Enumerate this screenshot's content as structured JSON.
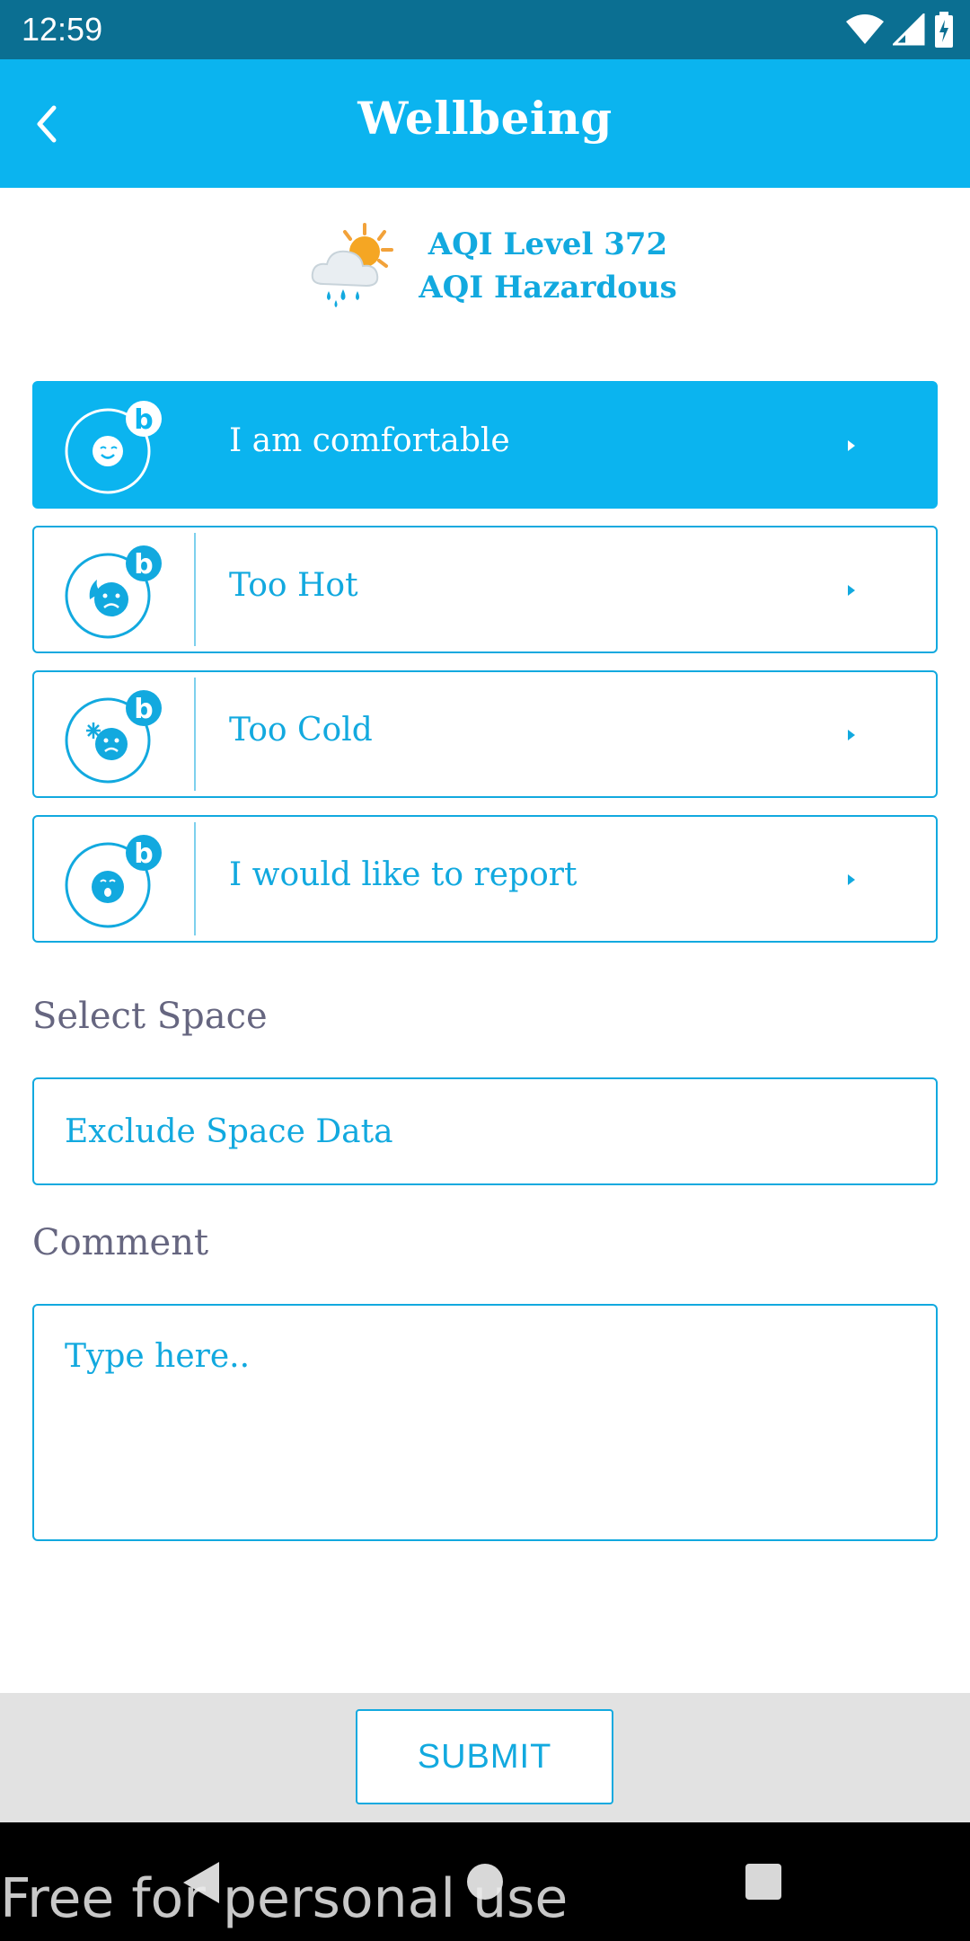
{
  "status_bar": {
    "time": "12:59",
    "icons": [
      "wifi-icon",
      "signal-icon",
      "battery-charging-icon"
    ]
  },
  "app_bar": {
    "title": "Wellbeing",
    "back_icon": "chevron-left-icon"
  },
  "aqi": {
    "icon": "weather-sun-rain-icon",
    "level": "AQI Level 372",
    "status": "AQI Hazardous"
  },
  "options": [
    {
      "label": "I am comfortable",
      "icon": "smile-face-icon",
      "active": true
    },
    {
      "label": "Too Hot",
      "icon": "hot-face-icon",
      "active": false
    },
    {
      "label": "Too Cold",
      "icon": "cold-face-icon",
      "active": false
    },
    {
      "label": "I would like to report",
      "icon": "surprised-face-icon",
      "active": false
    }
  ],
  "space": {
    "label": "Select Space",
    "value": "Exclude Space Data"
  },
  "comment": {
    "label": "Comment",
    "placeholder": "Type here.."
  },
  "submit": {
    "label": "SUBMIT"
  },
  "watermark": "Free for personal use",
  "colors": {
    "accent": "#0bb4ef",
    "status_bar": "#0b6f92",
    "text_secondary": "#666680"
  }
}
